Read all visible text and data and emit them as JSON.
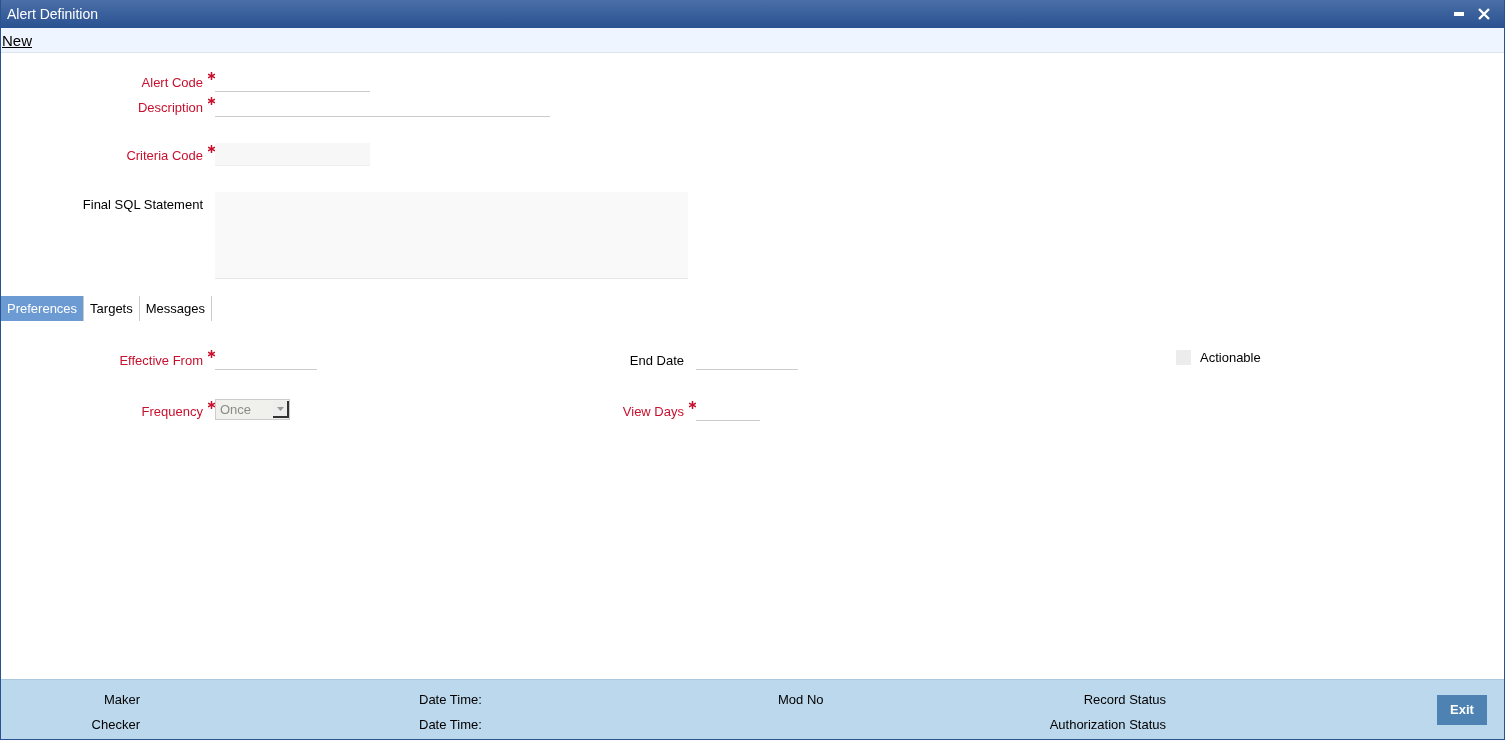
{
  "window": {
    "title": "Alert Definition"
  },
  "toolbar": {
    "links": [
      "New"
    ]
  },
  "header_fields": [
    {
      "label": "Alert Code",
      "required": true,
      "kind": "text"
    },
    {
      "label": "Description",
      "required": true,
      "kind": "wide"
    },
    {
      "label": "Criteria Code",
      "required": true,
      "kind": "readonly"
    },
    {
      "label": "Final SQL Statement",
      "required": false,
      "kind": "memo"
    }
  ],
  "tabs": [
    {
      "label": "Preferences",
      "selected": true
    },
    {
      "label": "Targets",
      "selected": false
    },
    {
      "label": "Messages",
      "selected": false
    }
  ],
  "preferences": {
    "effective_from": {
      "label": "Effective From",
      "required": true
    },
    "end_date": {
      "label": "End Date",
      "required": false
    },
    "actionable": {
      "label": "Actionable",
      "checked": false
    },
    "frequency": {
      "label": "Frequency",
      "required": true,
      "value": "Once"
    },
    "view_days": {
      "label": "View Days",
      "required": true
    }
  },
  "footer": {
    "maker": "Maker",
    "maker_date_time": "Date Time:",
    "mod_no": "Mod No",
    "record_status": "Record Status",
    "checker": "Checker",
    "checker_date_time": "Date Time:",
    "authorization_status": "Authorization Status",
    "exit_button": "Exit"
  }
}
